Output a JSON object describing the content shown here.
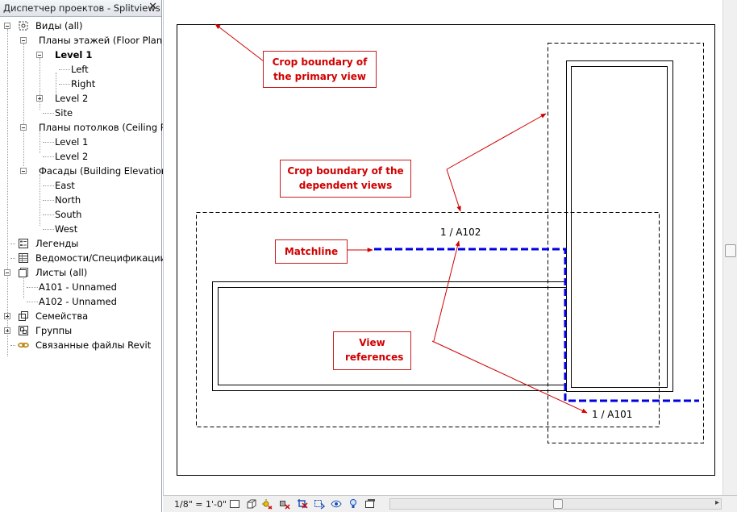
{
  "browser": {
    "title": "Диспетчер проектов - Splitviews",
    "close_glyph": "✕",
    "nodes": [
      {
        "label": "Виды (all)",
        "icon": "views-icon",
        "toggle": "minus"
      },
      {
        "label": "Планы этажей (Floor Plan)",
        "toggle": "minus"
      },
      {
        "label": "Level 1",
        "toggle": "minus",
        "bold": true
      },
      {
        "label": "Left"
      },
      {
        "label": "Right"
      },
      {
        "label": "Level 2",
        "toggle": "plus"
      },
      {
        "label": "Site"
      },
      {
        "label": "Планы потолков (Ceiling Pl",
        "toggle": "minus"
      },
      {
        "label": "Level 1"
      },
      {
        "label": "Level 2"
      },
      {
        "label": "Фасады (Building Elevation",
        "toggle": "minus"
      },
      {
        "label": "East"
      },
      {
        "label": "North"
      },
      {
        "label": "South"
      },
      {
        "label": "West"
      },
      {
        "label": "Легенды",
        "icon": "legend-icon"
      },
      {
        "label": "Ведомости/Спецификации",
        "icon": "schedule-icon"
      },
      {
        "label": "Листы (all)",
        "icon": "sheets-icon",
        "toggle": "minus"
      },
      {
        "label": "A101 - Unnamed"
      },
      {
        "label": "A102 - Unnamed"
      },
      {
        "label": "Семейства",
        "icon": "families-icon",
        "toggle": "plus"
      },
      {
        "label": "Группы",
        "icon": "groups-icon",
        "toggle": "plus"
      },
      {
        "label": "Связанные файлы Revit",
        "icon": "link-icon"
      }
    ]
  },
  "drawing": {
    "callouts": {
      "primary": "Crop boundary of the primary view",
      "dependent": "Crop boundary of the dependent views",
      "matchline": "Matchline",
      "view_refs": "View references"
    },
    "view_refs": {
      "top": "1 / A102",
      "bottom": "1 / A101"
    },
    "colors": {
      "annotation": "#d00000",
      "matchline": "#0000e0"
    }
  },
  "status": {
    "scale": "1/8\" = 1'-0\"",
    "icons": [
      "detail-level-icon",
      "visual-style-icon",
      "sun-path-icon",
      "shadows-icon",
      "crop-view-icon",
      "show-crop-icon",
      "temporary-hide-icon",
      "reveal-hidden-icon",
      "analysis-icon",
      "lightbulb-icon",
      "constraints-icon"
    ]
  }
}
